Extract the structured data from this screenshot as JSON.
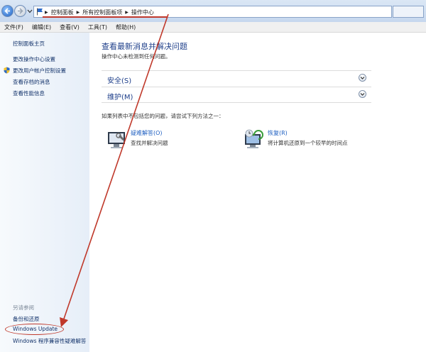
{
  "address_bar": {
    "crumbs": [
      "控制面板",
      "所有控制面板项",
      "操作中心"
    ]
  },
  "menu": [
    "文件(F)",
    "编辑(E)",
    "查看(V)",
    "工具(T)",
    "帮助(H)"
  ],
  "sidebar": {
    "home": "控制面板主页",
    "links": [
      "更改操作中心设置",
      "更改用户帐户控制设置",
      "查看存档的消息",
      "查看性能信息"
    ],
    "see_also_heading": "另请参阅",
    "see_also": [
      "备份和还原",
      "Windows Update",
      "Windows 程序兼容性疑难解答"
    ]
  },
  "main": {
    "heading": "查看最新消息并解决问题",
    "subtext": "操作中心未检测到任何问题。",
    "groups": [
      "安全(S)",
      "维护(M)"
    ],
    "prompt": "如果列表中不包括您的问题，请尝试下列方法之一：",
    "tools": [
      {
        "title": "疑难解答(O)",
        "desc": "查找并解决问题"
      },
      {
        "title": "恢复(R)",
        "desc": "将计算机还原到一个较早的时间点"
      }
    ]
  },
  "colors": {
    "link": "#1e5fc1",
    "heading": "#1e3f8a",
    "annotation": "#c0392b"
  }
}
